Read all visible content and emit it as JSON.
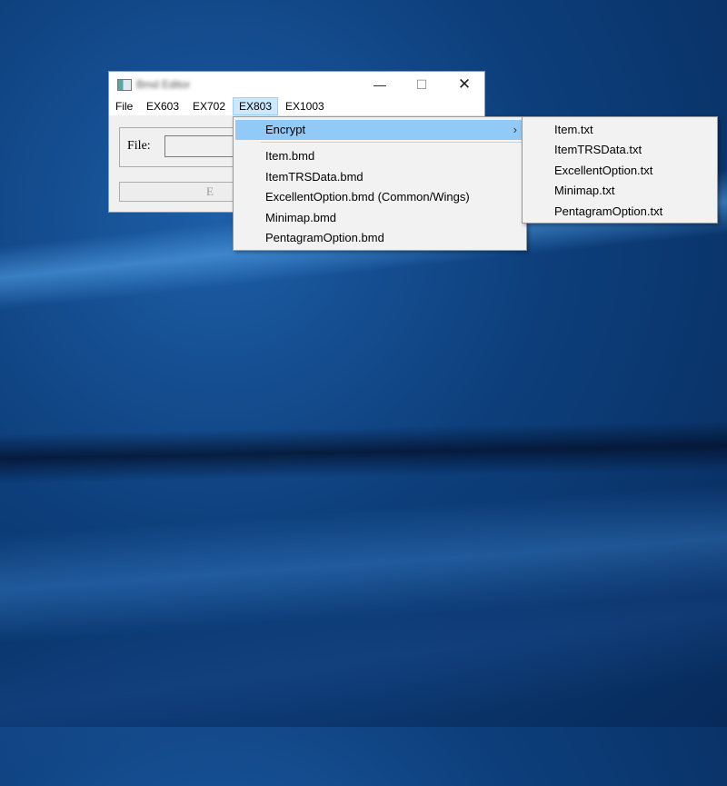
{
  "window": {
    "title": "Bmd Editor",
    "min_symbol": "—",
    "max_symbol": "☐",
    "close_symbol": "✕"
  },
  "menubar": {
    "items": [
      {
        "label": "File"
      },
      {
        "label": "EX603"
      },
      {
        "label": "EX702"
      },
      {
        "label": "EX803",
        "active": true
      },
      {
        "label": "EX1003"
      }
    ]
  },
  "form": {
    "file_label": "File:",
    "file_value": "",
    "action_label": "E"
  },
  "dropdown": {
    "items": [
      {
        "label": "Encrypt",
        "has_submenu": true,
        "arrow": "›"
      },
      {
        "label": "Item.bmd"
      },
      {
        "label": "ItemTRSData.bmd"
      },
      {
        "label": "ExcellentOption.bmd (Common/Wings)"
      },
      {
        "label": "Minimap.bmd"
      },
      {
        "label": "PentagramOption.bmd"
      }
    ]
  },
  "submenu": {
    "items": [
      {
        "label": "Item.txt"
      },
      {
        "label": "ItemTRSData.txt"
      },
      {
        "label": "ExcellentOption.txt"
      },
      {
        "label": "Minimap.txt"
      },
      {
        "label": "PentagramOption.txt"
      }
    ]
  },
  "colors": {
    "menu_hover": "#91c9f7",
    "menubar_active": "#cce8ff",
    "desktop": "#0d3f7c"
  }
}
